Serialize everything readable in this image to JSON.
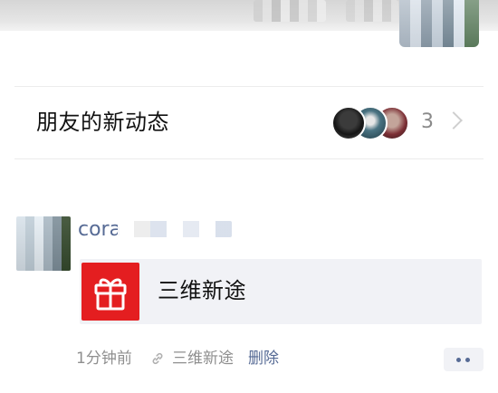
{
  "friends_updates": {
    "title": "朋友的新动态",
    "count": "3",
    "avatars": [
      "friend-avatar-1",
      "friend-avatar-2",
      "friend-avatar-3"
    ],
    "chevron_icon": "chevron-right-icon"
  },
  "post": {
    "username": "cora",
    "share": {
      "icon": "gift-icon",
      "icon_color": "#e41e20",
      "title": "三维新途"
    },
    "time": "1分钟前",
    "source_icon": "link-icon",
    "source": "三维新途",
    "delete_label": "删除",
    "more_icon": "more-dots-icon"
  },
  "colors": {
    "link_blue": "#576b95",
    "meta_gray": "#8f8f8f",
    "card_bg": "#f1f2f6"
  }
}
